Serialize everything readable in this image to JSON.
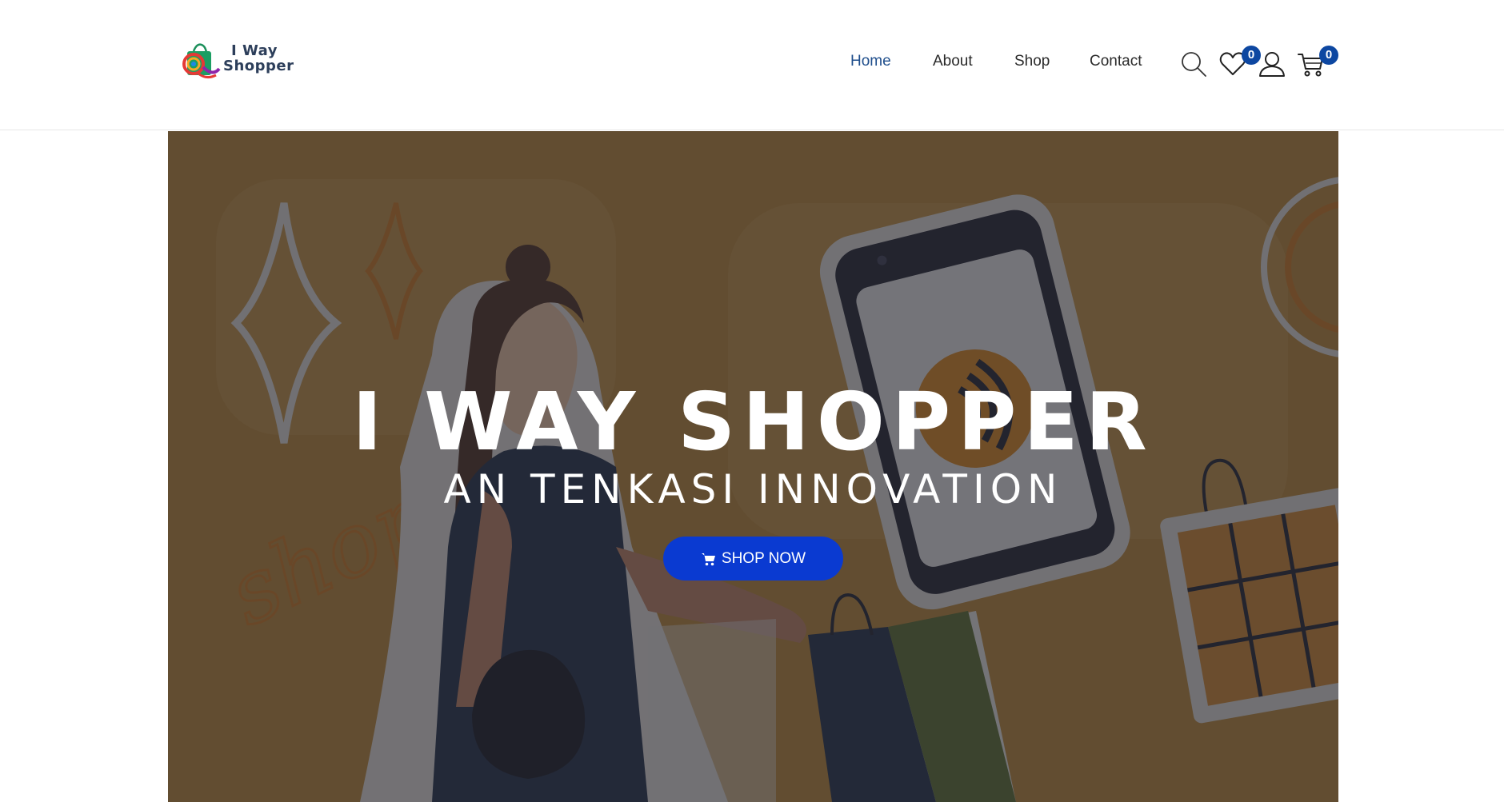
{
  "header": {
    "logo": {
      "line1": "I Way",
      "line2": "Shopper"
    },
    "nav": [
      {
        "label": "Home",
        "active": true
      },
      {
        "label": "About",
        "active": false
      },
      {
        "label": "Shop",
        "active": false
      },
      {
        "label": "Contact",
        "active": false
      }
    ],
    "icons": {
      "search": "search-icon",
      "wishlist": "heart-icon",
      "account": "user-icon",
      "cart": "cart-icon"
    },
    "wishlist_count": "0",
    "cart_count": "0"
  },
  "hero": {
    "title": "I WAY SHOPPER",
    "subtitle": "AN TENKASI INNOVATION",
    "cta_label": "SHOP NOW",
    "cta_icon": "cart-icon",
    "background_label": "shop"
  },
  "colors": {
    "nav_active": "#1f4e8c",
    "badge": "#0d47a1",
    "cta": "#0a3ad1",
    "hero_bg": "#b07a2b"
  }
}
